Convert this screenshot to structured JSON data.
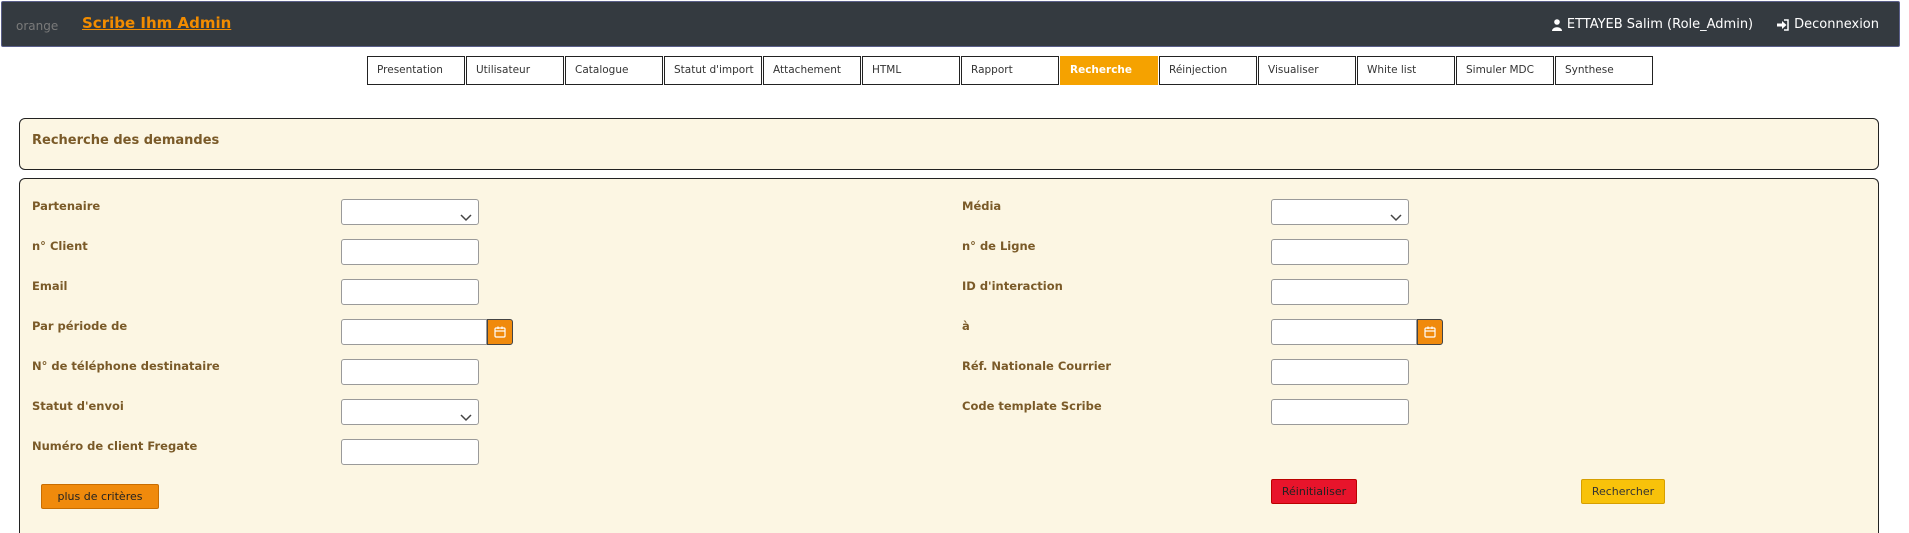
{
  "header": {
    "logo_alt": "orange",
    "app_title": "Scribe Ihm Admin",
    "user_label": "ETTAYEB Salim (Role_Admin)",
    "logout_label": "Deconnexion",
    "icons": {
      "user": "user-icon",
      "logout": "sign-in-icon"
    },
    "colors": {
      "bar": "#343a40",
      "brand": "#f28c00"
    }
  },
  "tabs": [
    {
      "label": "Presentation"
    },
    {
      "label": "Utilisateur"
    },
    {
      "label": "Catalogue"
    },
    {
      "label": "Statut d'import"
    },
    {
      "label": "Attachement"
    },
    {
      "label": "HTML"
    },
    {
      "label": "Rapport"
    },
    {
      "label": "Recherche",
      "active": true
    },
    {
      "label": "Réinjection"
    },
    {
      "label": "Visualiser"
    },
    {
      "label": "White list"
    },
    {
      "label": "Simuler MDC"
    },
    {
      "label": "Synthese"
    }
  ],
  "search_panel": {
    "title": "Recherche des demandes"
  },
  "form": {
    "left": {
      "partenaire": {
        "label": "Partenaire",
        "value": ""
      },
      "client": {
        "label": "n° Client",
        "value": ""
      },
      "email": {
        "label": "Email",
        "value": ""
      },
      "periode": {
        "label": "Par période de",
        "value": ""
      },
      "telephone": {
        "label": "N° de téléphone destinataire",
        "value": ""
      },
      "statut": {
        "label": "Statut d'envoi",
        "value": ""
      },
      "fregate": {
        "label": "Numéro de client Fregate",
        "value": ""
      }
    },
    "right": {
      "media": {
        "label": "Média",
        "value": ""
      },
      "ligne": {
        "label": "n° de Ligne",
        "value": ""
      },
      "interaction": {
        "label": "ID d'interaction",
        "value": ""
      },
      "periode_fin": {
        "label": "à",
        "value": ""
      },
      "ref_nationale": {
        "label": "Réf. Nationale Courrier",
        "value": ""
      },
      "code_template": {
        "label": "Code template Scribe",
        "value": ""
      }
    },
    "buttons": {
      "more": "plus de critères",
      "reset": "Réinitialiser",
      "search": "Rechercher"
    },
    "colors": {
      "label": "#7a5a28",
      "panel_bg": "#fcf6e3",
      "calendar": "#f08a0c",
      "reset": "#e8142b",
      "search": "#f8c20a",
      "active_tab": "#f5a200"
    }
  }
}
